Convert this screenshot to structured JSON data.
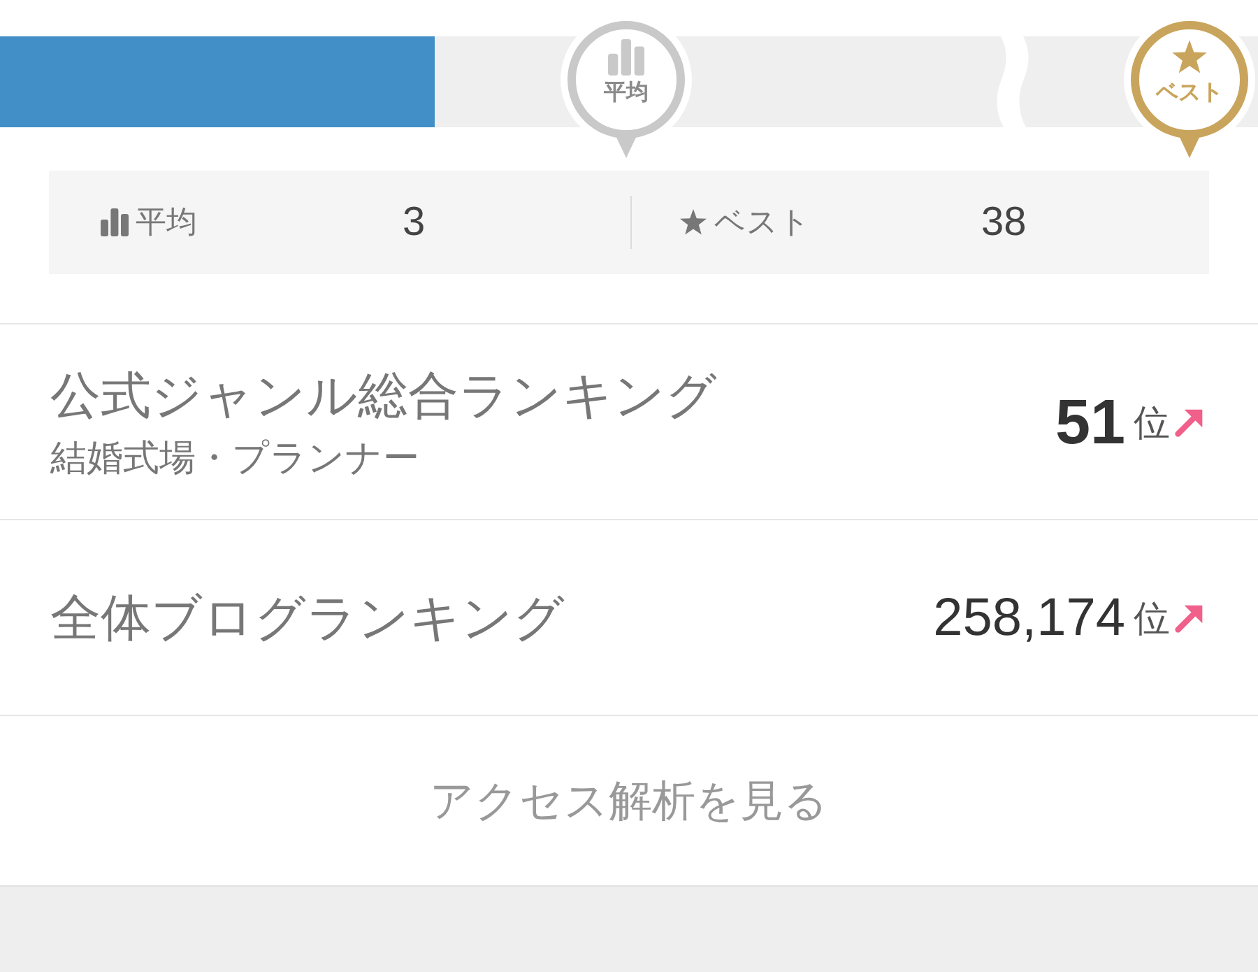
{
  "progress": {
    "level": 0.345,
    "markers": [
      {
        "kind": "average",
        "label": "平均"
      },
      {
        "kind": "best",
        "label": "ベスト"
      }
    ]
  },
  "stats": [
    {
      "kind": "average",
      "label": "平均",
      "value": "3"
    },
    {
      "kind": "best",
      "label": "ベスト",
      "value": "38"
    }
  ],
  "rankings": [
    {
      "title": "公式ジャンル総合ランキング",
      "subtitle": "結婚式場・プランナー",
      "rank": "51",
      "unit": "位",
      "highlighted": true,
      "rising": true
    },
    {
      "title": "全体ブログランキング",
      "rank": "258,174",
      "unit": "位",
      "highlighted": false,
      "rising": true
    }
  ],
  "access_link": "アクセス解析を見る"
}
